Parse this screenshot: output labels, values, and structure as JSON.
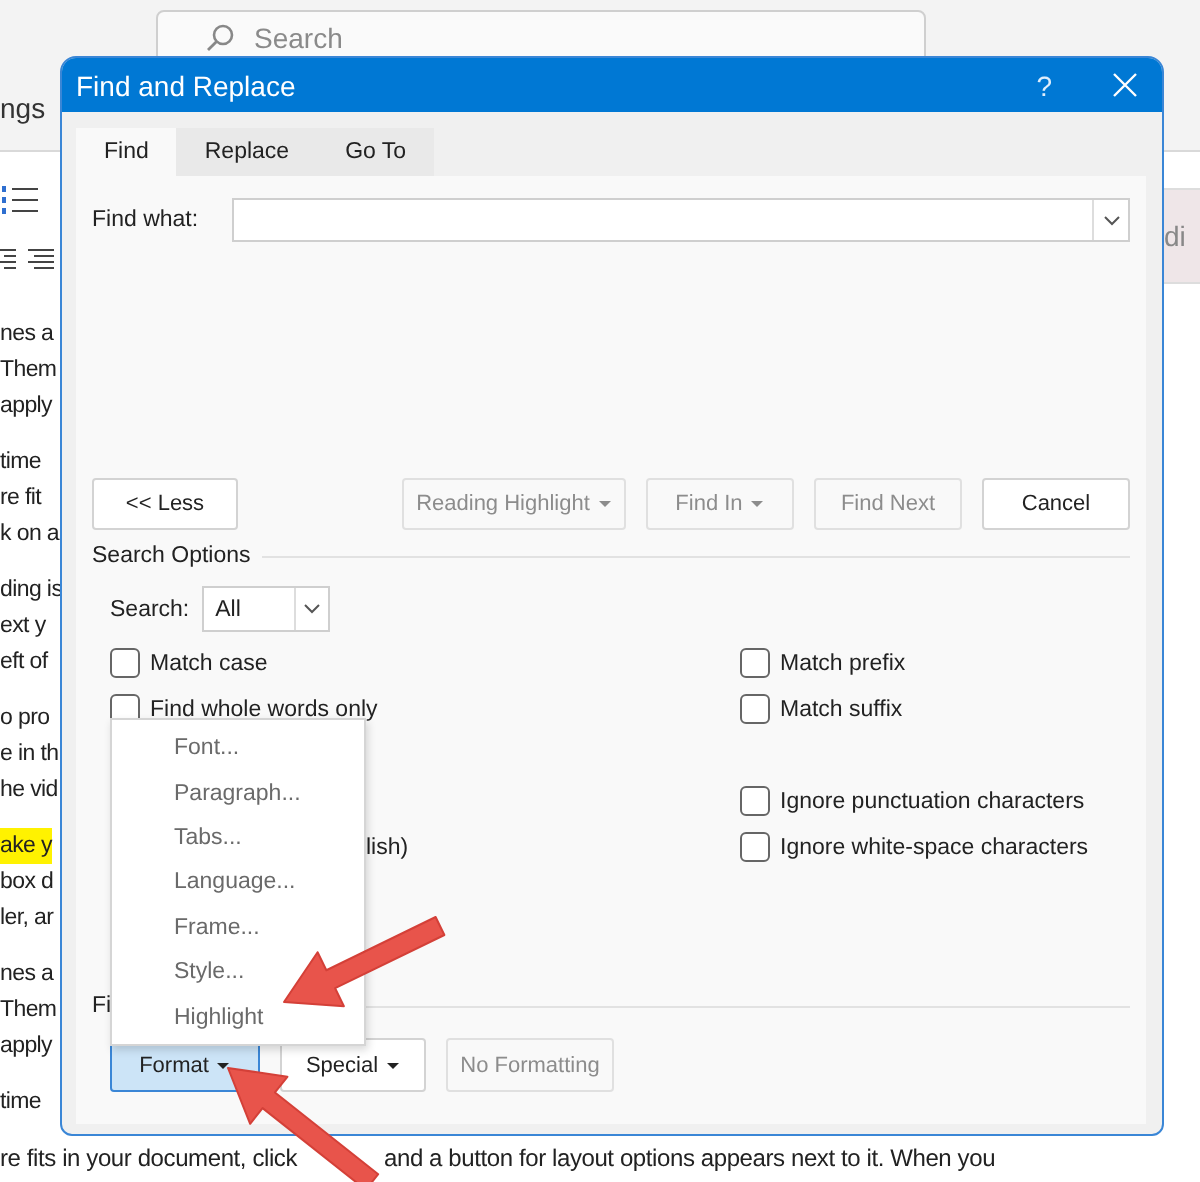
{
  "document": {
    "search_placeholder": "Search",
    "ribbon_label": "ngs",
    "side_button_fragment": "di",
    "paragraphs": [
      {
        "lines": [
          {
            "text": "nes a",
            "highlighted": false
          },
          {
            "text": "Them",
            "highlighted": false
          },
          {
            "text": "apply",
            "highlighted": false
          }
        ]
      },
      {
        "lines": [
          {
            "text": "time",
            "highlighted": false
          },
          {
            "text": "re fit",
            "highlighted": false
          },
          {
            "text": "k on a",
            "highlighted": false
          }
        ]
      },
      {
        "lines": [
          {
            "text": "ding is",
            "highlighted": false
          },
          {
            "text": "ext y",
            "highlighted": false
          },
          {
            "text": "eft of",
            "highlighted": false
          }
        ]
      },
      {
        "lines": [
          {
            "text": "o pro",
            "highlighted": false
          },
          {
            "text": "e in th",
            "highlighted": false
          },
          {
            "text": "he vid",
            "highlighted": false
          }
        ]
      },
      {
        "lines": [
          {
            "text": "ake y",
            "highlighted": true
          },
          {
            "text": "box d",
            "highlighted": false
          },
          {
            "text": "ler, ar",
            "highlighted": false
          }
        ]
      },
      {
        "lines": [
          {
            "text": "nes a",
            "highlighted": false
          },
          {
            "text": "Them",
            "highlighted": false
          },
          {
            "text": "apply",
            "highlighted": false
          }
        ]
      },
      {
        "lines": [
          {
            "text": "time",
            "highlighted": false
          }
        ]
      }
    ],
    "bottom_line": [
      "re fits in your document, click",
      "and a button for layout options appears next to it. When you"
    ]
  },
  "dialog": {
    "title": "Find and Replace",
    "help_symbol": "?",
    "tabs": [
      {
        "label": "Find",
        "selected": true
      },
      {
        "label": "Replace",
        "selected": false
      },
      {
        "label": "Go To",
        "selected": false
      }
    ],
    "find_what": {
      "label": "Find what:"
    },
    "action_buttons": [
      {
        "label": "<< Less",
        "disabled": false,
        "has_menu": false
      },
      {
        "label": "Reading Highlight",
        "disabled": true,
        "has_menu": true
      },
      {
        "label": "Find In",
        "disabled": true,
        "has_menu": true
      },
      {
        "label": "Find Next",
        "disabled": true,
        "has_menu": false
      },
      {
        "label": "Cancel",
        "disabled": false,
        "has_menu": false
      }
    ],
    "search_options": {
      "title": "Search Options",
      "search": {
        "label": "Search:",
        "value": "All"
      },
      "left_checkboxes": [
        {
          "label": "Match case",
          "checked": false
        },
        {
          "label": "Find whole words only",
          "checked": false
        }
      ],
      "partial_text": "lish)",
      "right_checkboxes": [
        {
          "label": "Match prefix",
          "checked": false
        },
        {
          "label": "Match suffix",
          "checked": false
        },
        {
          "label": "Ignore punctuation characters",
          "checked": false
        },
        {
          "label": "Ignore white-space characters",
          "checked": false
        }
      ]
    },
    "find_section_label": "Fi",
    "format_buttons": [
      {
        "label": "Format",
        "has_menu": true,
        "disabled": false,
        "selected": true
      },
      {
        "label": "Special",
        "has_menu": true,
        "disabled": false,
        "selected": false
      },
      {
        "label": "No Formatting",
        "has_menu": false,
        "disabled": true,
        "selected": false
      }
    ],
    "format_menu": {
      "items": [
        "Font...",
        "Paragraph...",
        "Tabs...",
        "Language...",
        "Frame...",
        "Style...",
        "Highlight"
      ]
    }
  }
}
